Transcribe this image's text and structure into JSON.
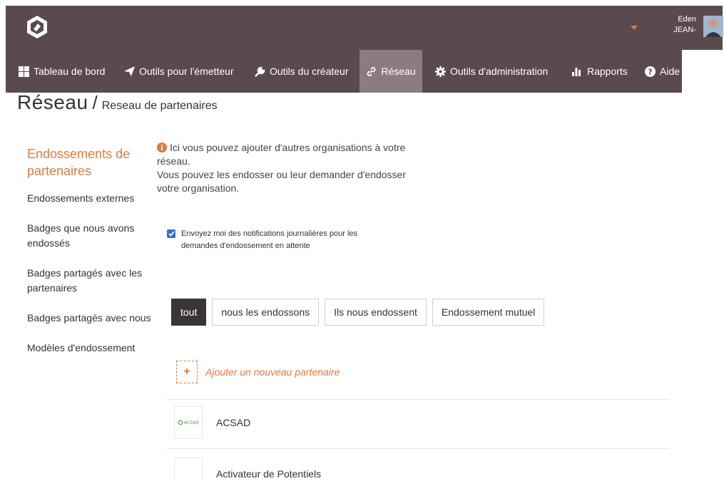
{
  "user": {
    "first_name": "Eden",
    "last_name": "JEAN-"
  },
  "nav": {
    "items": [
      {
        "label": "Tableau de bord",
        "icon": "dashboard-icon"
      },
      {
        "label": "Outils pour l'émetteur",
        "icon": "paper-plane-icon"
      },
      {
        "label": "Outils du créateur",
        "icon": "wrench-icon"
      },
      {
        "label": "Réseau",
        "icon": "link-icon",
        "active": true
      },
      {
        "label": "Outils d'administration",
        "icon": "gear-icon"
      },
      {
        "label": "Rapports",
        "icon": "bar-chart-icon"
      },
      {
        "label": "Aide",
        "icon": "help-icon"
      }
    ]
  },
  "breadcrumb": {
    "main": "Réseau",
    "separator": "/",
    "sub": "Reseau de partenaires"
  },
  "sidebar": {
    "title": "Endossements de partenaires",
    "items": [
      "Endossements externes",
      "Badges que nous avons endossés",
      "Badges partagés avec les partenaires",
      "Badges partagés avec nous",
      "Modèles d'endossement"
    ]
  },
  "info": {
    "line1": "Ici vous pouvez ajouter d'autres organisations à votre réseau.",
    "line2": "Vous pouvez les endosser ou leur demander d'endosser votre organisation."
  },
  "notifications": {
    "checked": true,
    "label": "Envoyez moi des notifications journalières pour les demandes d'endossement en attente"
  },
  "filters": [
    {
      "label": "tout",
      "active": true
    },
    {
      "label": "nous les endossons",
      "active": false
    },
    {
      "label": "Ils nous endossent",
      "active": false
    },
    {
      "label": "Endossement mutuel",
      "active": false
    }
  ],
  "add_partner": {
    "icon": "+",
    "label": "Ajouter un nouveau partenaire"
  },
  "partners": [
    {
      "name": "ACSAD",
      "logo_text": "ACSAD"
    },
    {
      "name": "Activateur de Potentiels",
      "logo_text": ""
    }
  ],
  "colors": {
    "header_bg": "#5b4a4d",
    "nav_active_bg": "#8c7c80",
    "accent": "#e07a3a",
    "filter_active_bg": "#3b3536",
    "checkbox": "#2f6fd2"
  }
}
